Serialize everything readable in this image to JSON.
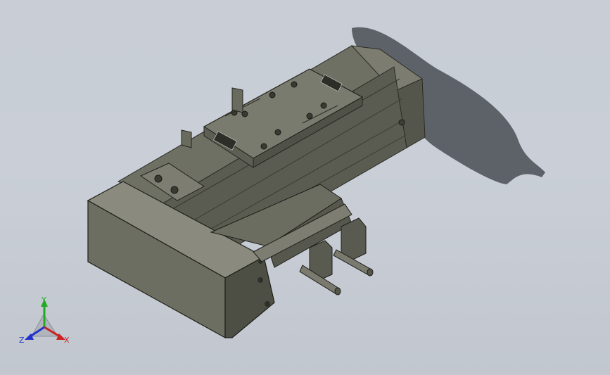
{
  "viewport": {
    "background_top": "#c8cdd6",
    "background_bottom": "#c2c7cf",
    "model_face_dark": "#4d4e44",
    "model_face_mid": "#6d6e62",
    "model_face_light": "#8a8b7e"
  },
  "triad": {
    "x_label": "X",
    "y_label": "Y",
    "z_label": "Z",
    "x_color": "#cc2222",
    "y_color": "#22aa22",
    "z_color": "#2233cc"
  }
}
